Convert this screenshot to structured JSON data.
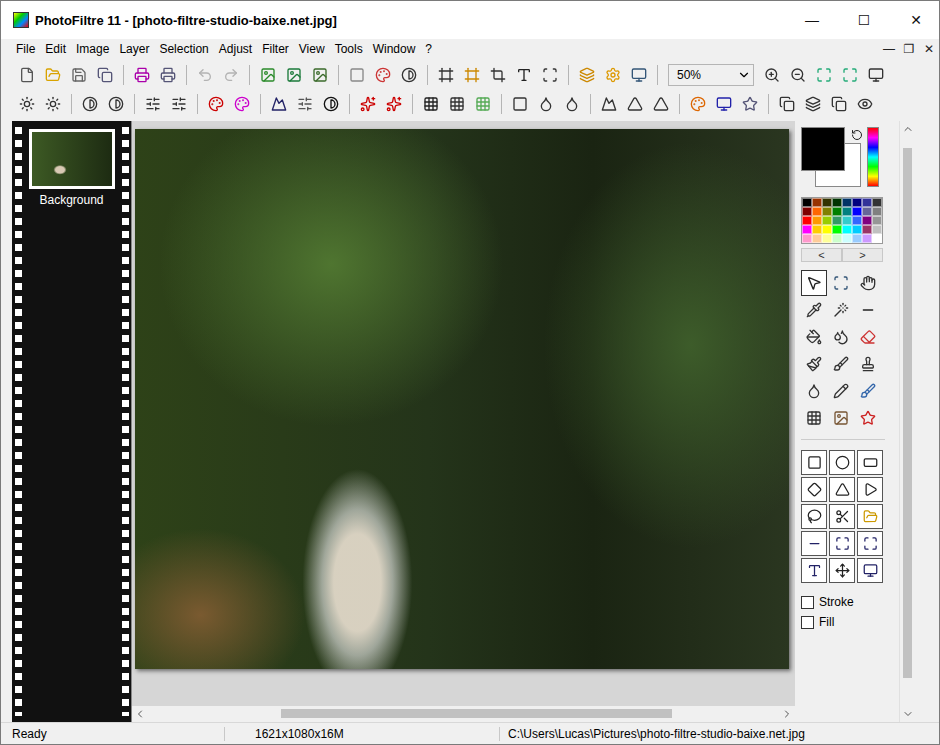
{
  "window": {
    "title": "PhotoFiltre 11 - [photo-filtre-studio-baixe.net.jpg]",
    "controls": [
      "—",
      "☐",
      "✕"
    ]
  },
  "menu": {
    "items": [
      "File",
      "Edit",
      "Image",
      "Layer",
      "Selection",
      "Adjust",
      "Filter",
      "View",
      "Tools",
      "Window",
      "?"
    ],
    "controls": [
      "—",
      "❐",
      "✕"
    ]
  },
  "toolbar": {
    "zoom": "50%",
    "undo": {
      "disabled": true
    },
    "redo": {
      "disabled": true
    }
  },
  "layers": [
    {
      "label": "Background",
      "selected": true
    }
  ],
  "canvas": {
    "scroll": {
      "level": 0.62,
      "position": 0.21
    }
  },
  "colors": {
    "foreground": "#000000",
    "background": "#ffffff"
  },
  "palette": {
    "colors": [
      "#000000",
      "#993300",
      "#333300",
      "#003300",
      "#003366",
      "#000080",
      "#333399",
      "#333333",
      "#800000",
      "#ff6600",
      "#808000",
      "#008000",
      "#008080",
      "#0000ff",
      "#666699",
      "#808080",
      "#ff0000",
      "#ff9900",
      "#99cc00",
      "#339966",
      "#33cccc",
      "#3366ff",
      "#800080",
      "#969696",
      "#ff00ff",
      "#ffcc00",
      "#ffff00",
      "#00ff00",
      "#00ffff",
      "#00ccff",
      "#993366",
      "#c0c0c0",
      "#ff99cc",
      "#ffcc99",
      "#ffff99",
      "#ccffcc",
      "#ccffff",
      "#99ccff",
      "#cc99ff",
      "#ffffff"
    ],
    "nav": [
      "<",
      ">"
    ]
  },
  "tools": [
    {
      "selected": true
    },
    {
      "selected": false
    },
    {
      "selected": false
    },
    {
      "selected": false
    },
    {
      "selected": false
    },
    {
      "selected": false
    },
    {
      "selected": false
    },
    {
      "selected": false
    },
    {
      "selected": false
    },
    {
      "selected": false
    },
    {
      "selected": false
    },
    {
      "selected": false
    },
    {
      "selected": false
    },
    {
      "selected": false
    },
    {
      "selected": false
    },
    {
      "selected": false
    },
    {
      "selected": false
    },
    {
      "selected": false
    }
  ],
  "shapes": [
    {
      "selected": false
    },
    {
      "selected": false
    },
    {
      "selected": false
    },
    {
      "selected": false
    },
    {
      "selected": false
    },
    {
      "selected": false
    },
    {
      "selected": false
    },
    {
      "selected": false
    },
    {
      "selected": false
    },
    {
      "selected": false
    },
    {
      "selected": false
    },
    {
      "selected": false
    },
    {
      "selected": false
    },
    {
      "selected": false
    },
    {
      "selected": false
    }
  ],
  "options": [
    {
      "label": "Stroke",
      "checked": false
    },
    {
      "label": "Fill",
      "checked": false
    }
  ],
  "side_scroll": {
    "level": 0.93,
    "position": 0.02
  },
  "status_bar": {
    "state": "Ready",
    "size": "1621x1080x16M",
    "path": "C:\\Users\\Lucas\\Pictures\\photo-filtre-studio-baixe.net.jpg"
  }
}
